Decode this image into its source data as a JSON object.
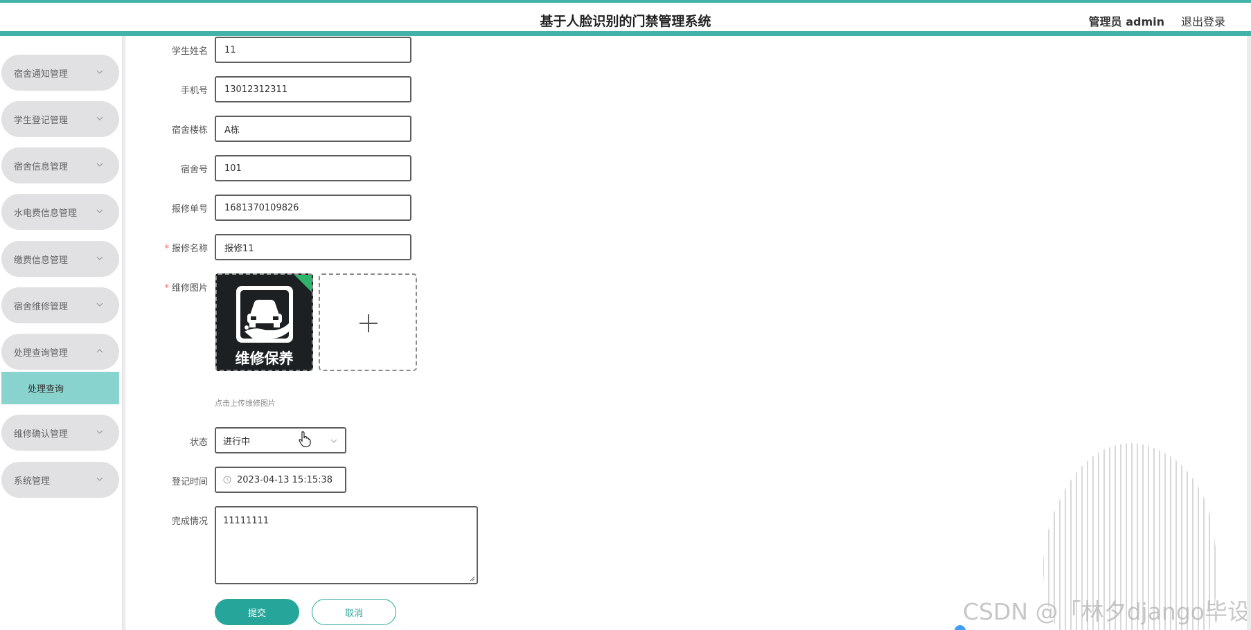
{
  "header": {
    "title": "基于人脸识别的门禁管理系统",
    "user": "管理员 admin",
    "logout": "退出登录"
  },
  "sidebar": {
    "items": [
      {
        "label": "宿舍通知管理"
      },
      {
        "label": "学生登记管理"
      },
      {
        "label": "宿舍信息管理"
      },
      {
        "label": "水电费信息管理"
      },
      {
        "label": "缴费信息管理"
      },
      {
        "label": "宿舍维修管理"
      },
      {
        "label": "处理查询管理"
      },
      {
        "label": "维修确认管理"
      },
      {
        "label": "系统管理"
      }
    ],
    "active_sub": "处理查询"
  },
  "form": {
    "student_name": {
      "label": "学生姓名",
      "value": "11"
    },
    "phone": {
      "label": "手机号",
      "value": "13012312311"
    },
    "building": {
      "label": "宿舍楼栋",
      "value": "A栋"
    },
    "room": {
      "label": "宿舍号",
      "value": "101"
    },
    "repair_no": {
      "label": "报修单号",
      "value": "1681370109826"
    },
    "repair_name": {
      "label": "报修名称",
      "value": "报修11"
    },
    "repair_image": {
      "label": "维修图片",
      "thumb_text": "维修保养",
      "hint": "点击上传维修图片"
    },
    "status": {
      "label": "状态",
      "value": "进行中"
    },
    "reg_time": {
      "label": "登记时间",
      "value": "2023-04-13 15:15:38"
    },
    "completion": {
      "label": "完成情况",
      "value": "11111111"
    },
    "submit": "提交",
    "cancel": "取消"
  },
  "watermark": "CSDN @「林夕django毕设",
  "colors": {
    "accent": "#43b3aa",
    "submit": "#26a69a",
    "sidebar_active": "#89d3cf",
    "sidebar_item": "#e1e1e3"
  }
}
